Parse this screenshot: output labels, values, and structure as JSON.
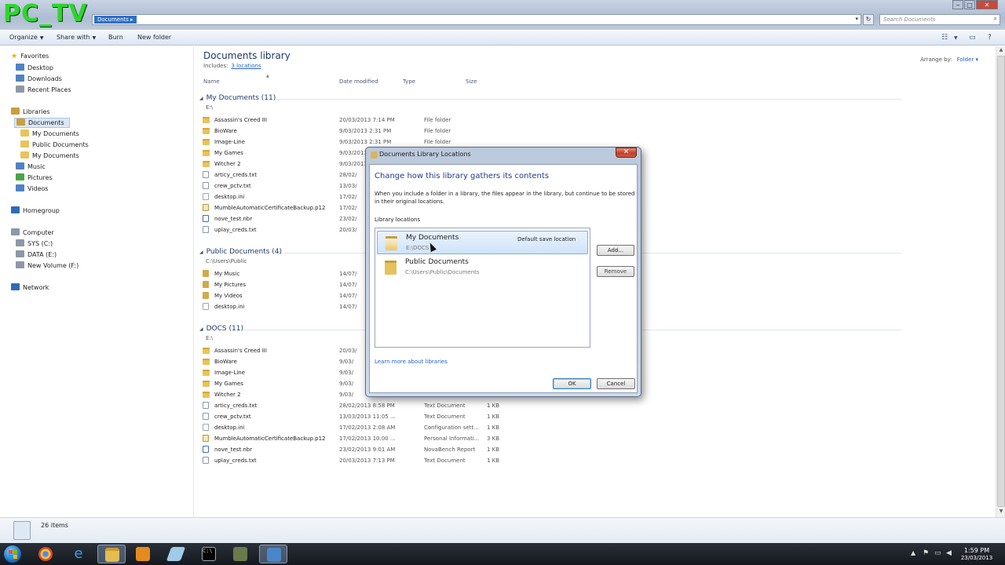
{
  "logo_text": "PC_TV",
  "address": {
    "text": "Documents ▸"
  },
  "search": {
    "placeholder": "Search Documents"
  },
  "toolbar": {
    "organize": "Organize",
    "share_with": "Share with",
    "burn": "Burn",
    "new_folder": "New folder"
  },
  "nav": {
    "favorites": "Favorites",
    "desktop": "Desktop",
    "downloads": "Downloads",
    "recent_places": "Recent Places",
    "libraries": "Libraries",
    "documents": "Documents",
    "my_documents": "My Documents",
    "public_documents": "Public Documents",
    "my_documents_2": "My Documents",
    "music": "Music",
    "pictures": "Pictures",
    "videos": "Videos",
    "homegroup": "Homegroup",
    "computer": "Computer",
    "sys_c": "SYS (C:)",
    "data_e": "DATA (E:)",
    "new_volume_f": "New Volume (F:)",
    "network": "Network"
  },
  "library": {
    "title": "Documents library",
    "includes_label": "Includes:",
    "includes_link": "3 locations",
    "arrange_label": "Arrange by:",
    "arrange_value": "Folder ▾"
  },
  "columns": {
    "name": "Name",
    "date": "Date modified",
    "type": "Type",
    "size": "Size"
  },
  "groups": [
    {
      "title": "My Documents (11)",
      "path": "E:\\",
      "rows": [
        {
          "icon": "folder",
          "name": "Assassin's Creed III",
          "date": "20/03/2013 7:14 PM",
          "type": "File folder",
          "size": ""
        },
        {
          "icon": "folder",
          "name": "BioWare",
          "date": "9/03/2013 2:31 PM",
          "type": "File folder",
          "size": ""
        },
        {
          "icon": "folder",
          "name": "Image-Line",
          "date": "9/03/2013 2:31 PM",
          "type": "File folder",
          "size": ""
        },
        {
          "icon": "folder",
          "name": "My Games",
          "date": "9/03/2013",
          "type": "",
          "size": ""
        },
        {
          "icon": "folder",
          "name": "Witcher 2",
          "date": "9/03/2013",
          "type": "",
          "size": ""
        },
        {
          "icon": "txt",
          "name": "articy_creds.txt",
          "date": "28/02/",
          "type": "",
          "size": ""
        },
        {
          "icon": "txt",
          "name": "crew_pctv.txt",
          "date": "13/03/",
          "type": "",
          "size": ""
        },
        {
          "icon": "ini",
          "name": "desktop.ini",
          "date": "17/02/",
          "type": "",
          "size": ""
        },
        {
          "icon": "cert",
          "name": "MumbleAutomaticCertificateBackup.p12",
          "date": "17/02/",
          "type": "",
          "size": ""
        },
        {
          "icon": "nbr",
          "name": "nove_test.nbr",
          "date": "23/02/",
          "type": "",
          "size": ""
        },
        {
          "icon": "txt",
          "name": "uplay_creds.txt",
          "date": "20/03/",
          "type": "",
          "size": ""
        }
      ]
    },
    {
      "title": "Public Documents (4)",
      "path": "C:\\Users\\Public",
      "rows": [
        {
          "icon": "lib",
          "name": "My Music",
          "date": "14/07/",
          "type": "",
          "size": ""
        },
        {
          "icon": "lib",
          "name": "My Pictures",
          "date": "14/07/",
          "type": "",
          "size": ""
        },
        {
          "icon": "lib",
          "name": "My Videos",
          "date": "14/07/",
          "type": "",
          "size": ""
        },
        {
          "icon": "ini",
          "name": "desktop.ini",
          "date": "14/07/",
          "type": "",
          "size": ""
        }
      ]
    },
    {
      "title": "DOCS (11)",
      "path": "E:\\",
      "rows": [
        {
          "icon": "folder",
          "name": "Assassin's Creed III",
          "date": "20/03/",
          "type": "",
          "size": ""
        },
        {
          "icon": "folder",
          "name": "BioWare",
          "date": "9/03/",
          "type": "",
          "size": ""
        },
        {
          "icon": "folder",
          "name": "Image-Line",
          "date": "9/03/",
          "type": "",
          "size": ""
        },
        {
          "icon": "folder",
          "name": "My Games",
          "date": "9/03/",
          "type": "",
          "size": ""
        },
        {
          "icon": "folder",
          "name": "Witcher 2",
          "date": "9/03/",
          "type": "",
          "size": ""
        },
        {
          "icon": "txt",
          "name": "articy_creds.txt",
          "date": "28/02/2013 8:58 PM",
          "type": "Text Document",
          "size": "1 KB"
        },
        {
          "icon": "txt",
          "name": "crew_pctv.txt",
          "date": "13/03/2013 11:05 ...",
          "type": "Text Document",
          "size": "1 KB"
        },
        {
          "icon": "ini",
          "name": "desktop.ini",
          "date": "17/02/2013 2:08 AM",
          "type": "Configuration sett...",
          "size": "1 KB"
        },
        {
          "icon": "cert",
          "name": "MumbleAutomaticCertificateBackup.p12",
          "date": "17/02/2013 10:00 ...",
          "type": "Personal Informati...",
          "size": "3 KB"
        },
        {
          "icon": "nbr",
          "name": "nove_test.nbr",
          "date": "23/02/2013 9:01 AM",
          "type": "NovaBench Report",
          "size": "1 KB"
        },
        {
          "icon": "txt",
          "name": "uplay_creds.txt",
          "date": "20/03/2013 7:13 PM",
          "type": "Text Document",
          "size": "1 KB"
        }
      ]
    }
  ],
  "details": {
    "count": "26 items"
  },
  "dialog": {
    "title": "Documents Library Locations",
    "heading": "Change how this library gathers its contents",
    "description": "When you include a folder in a library, the files appear in the library, but continue to be stored in their original locations.",
    "locations_label": "Library locations",
    "locations": [
      {
        "name": "My Documents",
        "path": "E:\\DOCS",
        "default": "Default save location"
      },
      {
        "name": "Public Documents",
        "path": "C:\\Users\\Public\\Documents",
        "default": ""
      }
    ],
    "add_label": "Add...",
    "remove_label": "Remove",
    "learn_link": "Learn more about libraries",
    "ok_label": "OK",
    "cancel_label": "Cancel"
  },
  "clock": {
    "time": "1:59 PM",
    "date": "23/03/2013"
  }
}
